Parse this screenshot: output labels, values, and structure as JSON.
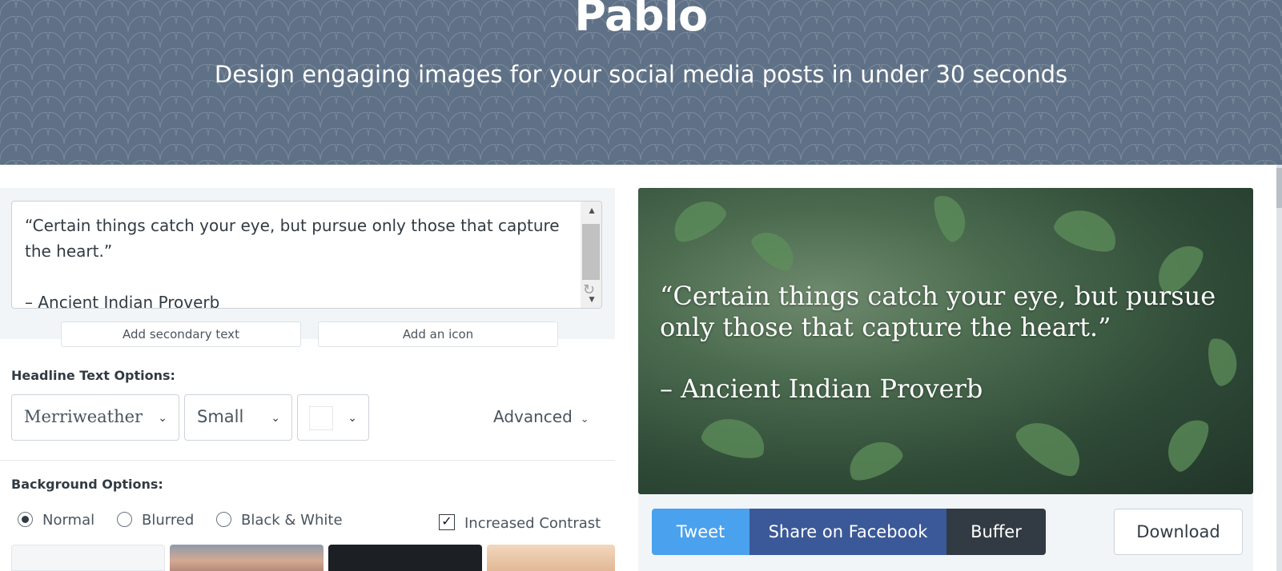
{
  "header": {
    "title": "Pablo",
    "subtitle": "Design engaging images for your social media posts in under 30 seconds"
  },
  "editor": {
    "quote_text": "“Certain things catch your eye, but pursue only those that capture the heart.”\n\n– Ancient Indian Proverb",
    "add_secondary_text": "Add secondary text",
    "add_icon": "Add an icon"
  },
  "headline_options": {
    "label": "Headline Text Options:",
    "font": "Merriweather",
    "size": "Small",
    "color": "#ffffff",
    "advanced": "Advanced"
  },
  "background_options": {
    "label": "Background Options:",
    "modes": [
      {
        "label": "Normal",
        "selected": true
      },
      {
        "label": "Blurred",
        "selected": false
      },
      {
        "label": "Black & White",
        "selected": false
      }
    ],
    "increased_contrast": {
      "label": "Increased Contrast",
      "checked": true
    }
  },
  "preview": {
    "quote": "“Certain things catch your eye, but pursue only those that capture the heart.”",
    "author": "– Ancient Indian Proverb"
  },
  "share": {
    "tweet": "Tweet",
    "facebook": "Share on Facebook",
    "buffer": "Buffer",
    "download": "Download"
  },
  "colors": {
    "header_bg": "#5f7186",
    "tweet": "#4aa1ee",
    "facebook": "#3b5998",
    "buffer": "#323b43"
  }
}
